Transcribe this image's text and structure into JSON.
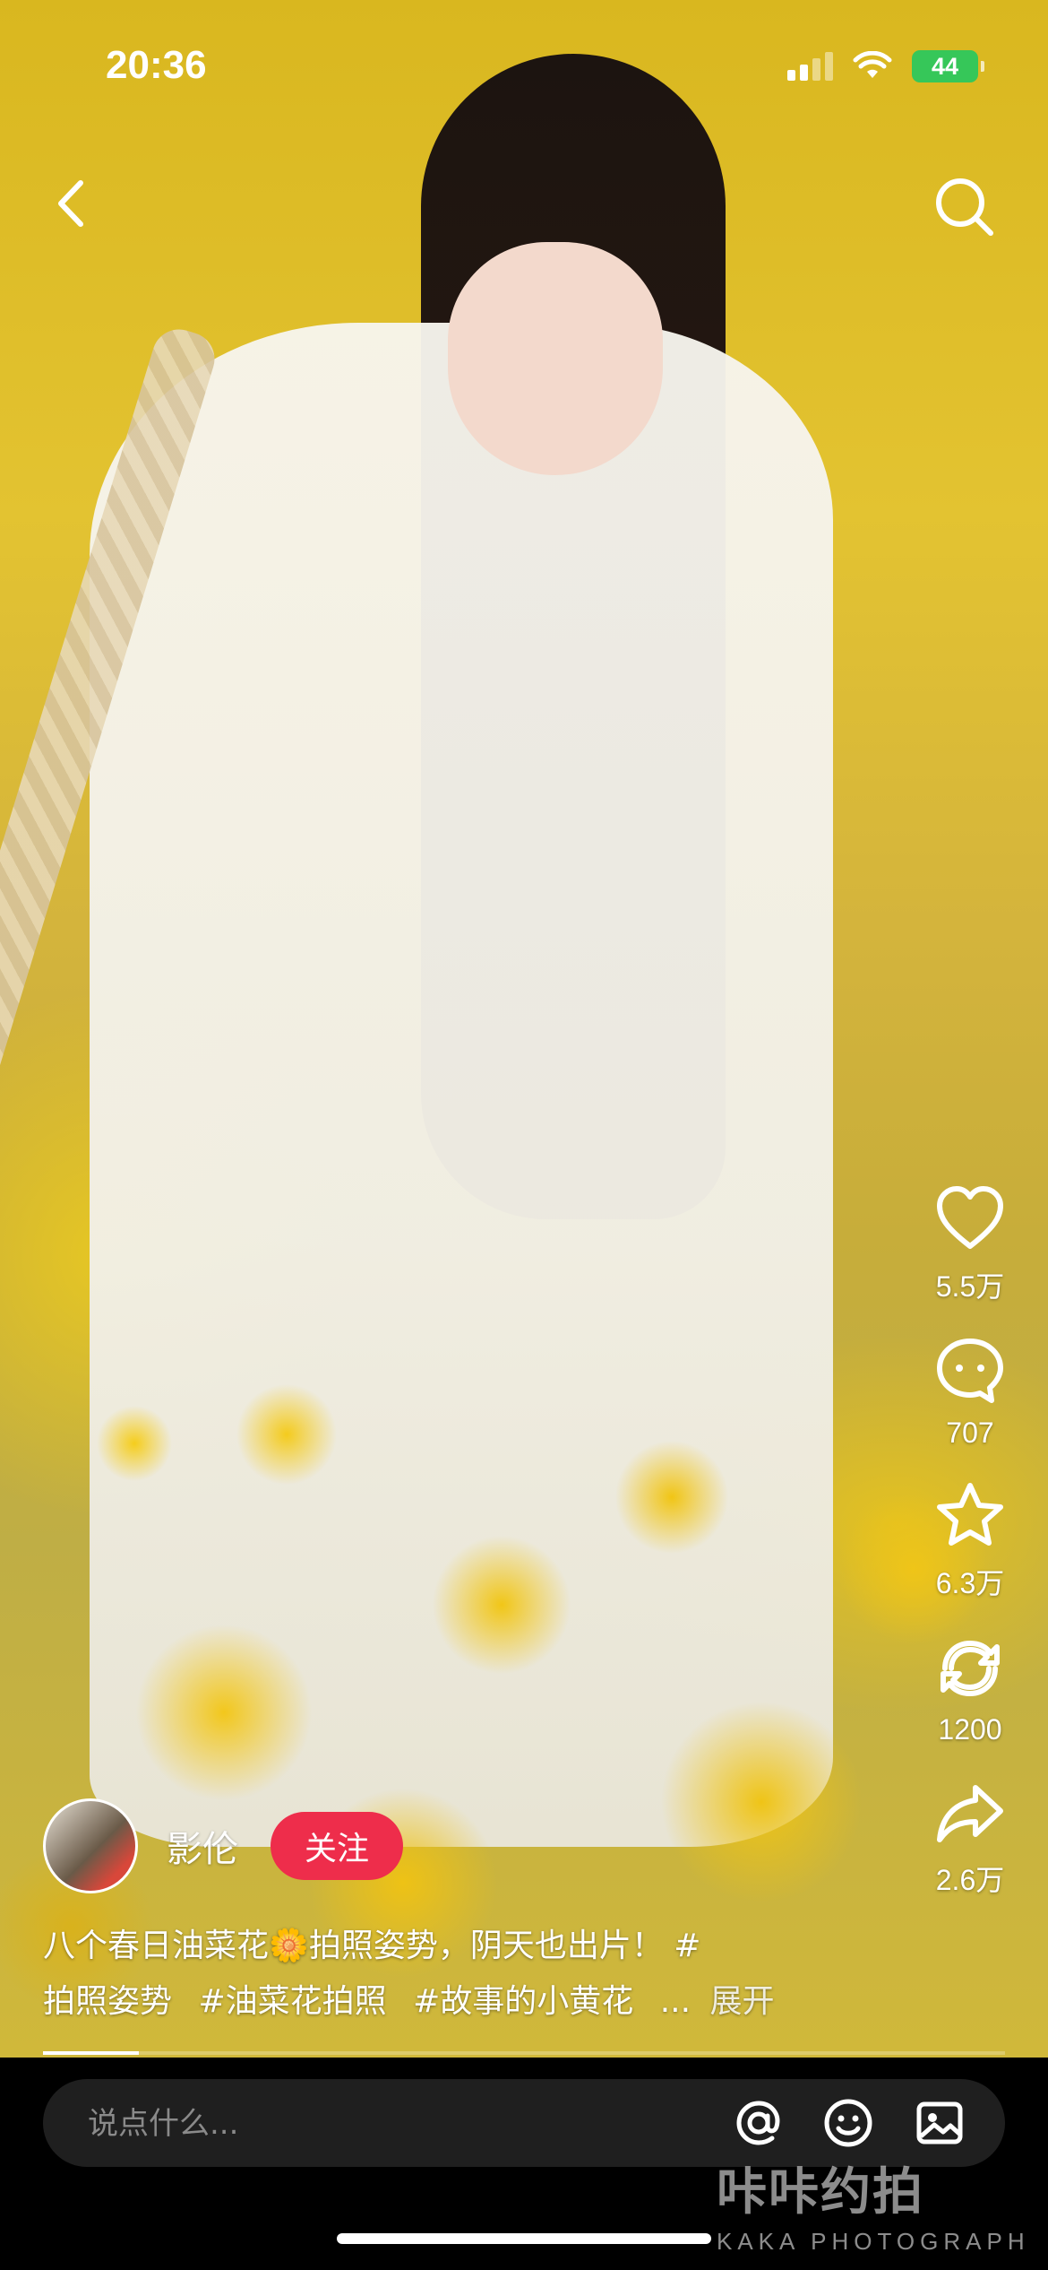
{
  "status_bar": {
    "time": "20:36",
    "battery": "44",
    "signal_bars": 4,
    "signal_active": 2
  },
  "nav": {
    "back_icon": "chevron-left-icon",
    "search_icon": "search-icon"
  },
  "actions": [
    {
      "id": "like",
      "icon": "heart-icon",
      "count": "5.5万"
    },
    {
      "id": "comment",
      "icon": "comment-icon",
      "count": "707"
    },
    {
      "id": "favorite",
      "icon": "star-icon",
      "count": "6.3万"
    },
    {
      "id": "repost",
      "icon": "repost-icon",
      "count": "1200"
    },
    {
      "id": "share",
      "icon": "share-icon",
      "count": "2.6万"
    }
  ],
  "author": {
    "name": "影伦",
    "follow_label": "关注"
  },
  "caption": {
    "text": "八个春日油菜花🌼拍照姿势，阴天也出片！ #",
    "tags": [
      "拍照姿势",
      "#油菜花拍照",
      "#故事的小黄花"
    ],
    "ellipsis": "...",
    "expand": "展开"
  },
  "progress": {
    "fraction": 0.1
  },
  "comment_bar": {
    "placeholder": "说点什么...",
    "icons": [
      "at-icon",
      "emoji-icon",
      "image-icon"
    ]
  },
  "watermark": {
    "main": "咔咔约拍",
    "sub": "KAKA PHOTOGRAPH"
  },
  "colors": {
    "follow": "#ee2d4b",
    "battery": "#36c759",
    "bottom_bar": "#000000"
  }
}
